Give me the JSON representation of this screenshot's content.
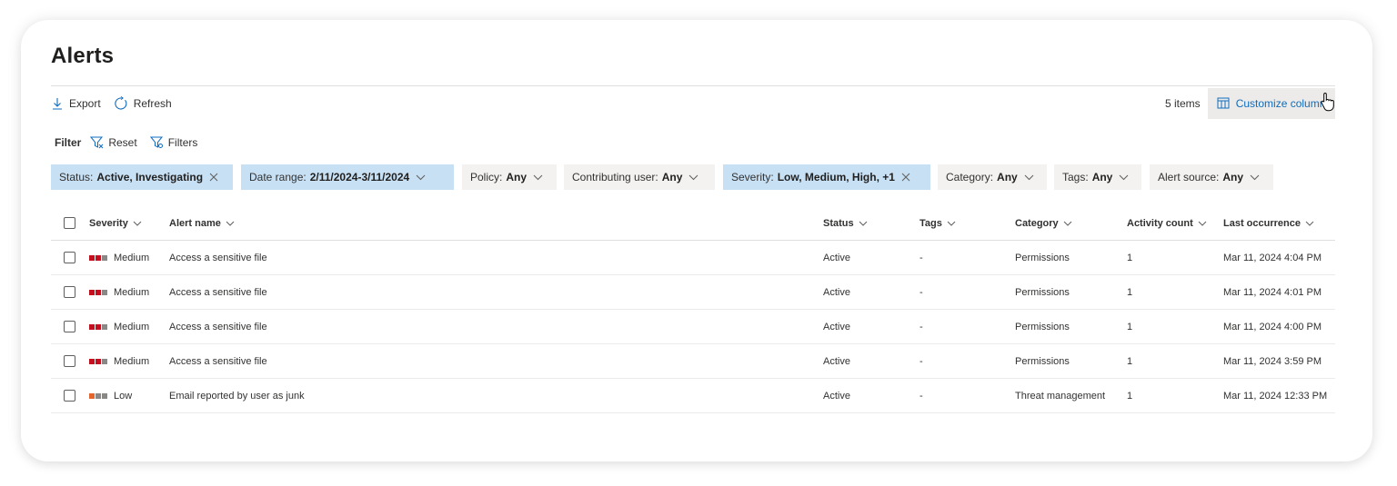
{
  "page": {
    "title": "Alerts"
  },
  "toolbar": {
    "export_label": "Export",
    "refresh_label": "Refresh",
    "items_count": "5 items",
    "customize_label": "Customize columns"
  },
  "filterbar": {
    "label": "Filter",
    "reset_label": "Reset",
    "filters_label": "Filters"
  },
  "chips": [
    {
      "label": "Status:",
      "value": "Active, Investigating",
      "icon": "close-icon"
    },
    {
      "label": "Date range:",
      "value": "2/11/2024-3/11/2024",
      "icon": "chevron-down-icon"
    },
    {
      "label": "Policy:",
      "value": "Any",
      "icon": "chevron-down-icon"
    },
    {
      "label": "Contributing user:",
      "value": "Any",
      "icon": "chevron-down-icon"
    },
    {
      "label": "Severity:",
      "value": "Low, Medium, High, +1",
      "icon": "close-icon"
    },
    {
      "label": "Category:",
      "value": "Any",
      "icon": "chevron-down-icon"
    },
    {
      "label": "Tags:",
      "value": "Any",
      "icon": "chevron-down-icon"
    },
    {
      "label": "Alert source:",
      "value": "Any",
      "icon": "chevron-down-icon"
    }
  ],
  "table": {
    "columns": [
      "Severity",
      "Alert name",
      "Status",
      "Tags",
      "Category",
      "Activity count",
      "Last occurrence"
    ],
    "rows": [
      {
        "severity": "Medium",
        "alert_name": "Access a sensitive file",
        "status": "Active",
        "tags": "-",
        "category": "Permissions",
        "activity_count": "1",
        "last_occurrence": "Mar 11, 2024 4:04 PM"
      },
      {
        "severity": "Medium",
        "alert_name": "Access a sensitive file",
        "status": "Active",
        "tags": "-",
        "category": "Permissions",
        "activity_count": "1",
        "last_occurrence": "Mar 11, 2024 4:01 PM"
      },
      {
        "severity": "Medium",
        "alert_name": "Access a sensitive file",
        "status": "Active",
        "tags": "-",
        "category": "Permissions",
        "activity_count": "1",
        "last_occurrence": "Mar 11, 2024 4:00 PM"
      },
      {
        "severity": "Medium",
        "alert_name": "Access a sensitive file",
        "status": "Active",
        "tags": "-",
        "category": "Permissions",
        "activity_count": "1",
        "last_occurrence": "Mar 11, 2024 3:59 PM"
      },
      {
        "severity": "Low",
        "alert_name": "Email reported by user as junk",
        "status": "Active",
        "tags": "-",
        "category": "Threat management",
        "activity_count": "1",
        "last_occurrence": "Mar 11, 2024 12:33 PM"
      }
    ]
  },
  "colors": {
    "accent": "#0f6cbd",
    "chip_active": "#c7e0f4",
    "severity_medium": "#c50f1f",
    "severity_low": "#e3642c",
    "severity_off": "#8a8886"
  }
}
